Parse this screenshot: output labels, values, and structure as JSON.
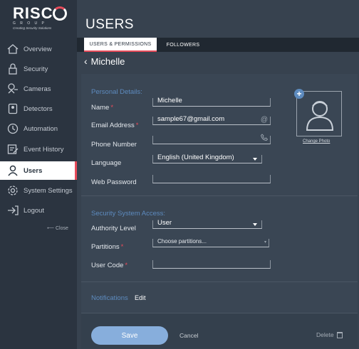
{
  "brand": {
    "name": "RISC",
    "subtitle": "G R O U P",
    "tagline": "Creating Security Solutions"
  },
  "sidebar": {
    "items": [
      {
        "label": "Overview",
        "icon": "home-icon"
      },
      {
        "label": "Security",
        "icon": "lock-icon"
      },
      {
        "label": "Cameras",
        "icon": "camera-icon"
      },
      {
        "label": "Detectors",
        "icon": "detector-icon"
      },
      {
        "label": "Automation",
        "icon": "automation-icon"
      },
      {
        "label": "Event History",
        "icon": "history-icon"
      },
      {
        "label": "Users",
        "icon": "user-icon"
      },
      {
        "label": "System Settings",
        "icon": "gear-icon"
      },
      {
        "label": "Logout",
        "icon": "logout-icon"
      }
    ],
    "active": "Users",
    "close_label": "Close"
  },
  "page": {
    "title": "USERS",
    "tabs": [
      {
        "label": "USERS & PERMISSIONS",
        "active": true
      },
      {
        "label": "FOLLOWERS",
        "active": false
      }
    ],
    "user_name": "Michelle"
  },
  "form": {
    "personal_title": "Personal Details:",
    "name_label": "Name",
    "name_value": "Michelle",
    "email_label": "Email Address",
    "email_value": "sample67@gmail.com",
    "phone_label": "Phone Number",
    "phone_value": "",
    "language_label": "Language",
    "language_value": "English (United Kingdom)",
    "web_password_label": "Web Password",
    "web_password_value": "",
    "change_photo": "Change Photo",
    "security_title": "Security System Access:",
    "authority_label": "Authority Level",
    "authority_value": "User",
    "partitions_label": "Partitions",
    "partitions_placeholder": "Choose partitions...",
    "user_code_label": "User Code",
    "user_code_value": "",
    "notifications_label": "Notifications",
    "notifications_edit": "Edit"
  },
  "footer": {
    "save_label": "Save",
    "cancel_label": "Cancel",
    "delete_label": "Delete"
  },
  "colors": {
    "accent": "#e74b5a",
    "section_blue": "#5d8bbf",
    "save_button": "#87aedc"
  }
}
